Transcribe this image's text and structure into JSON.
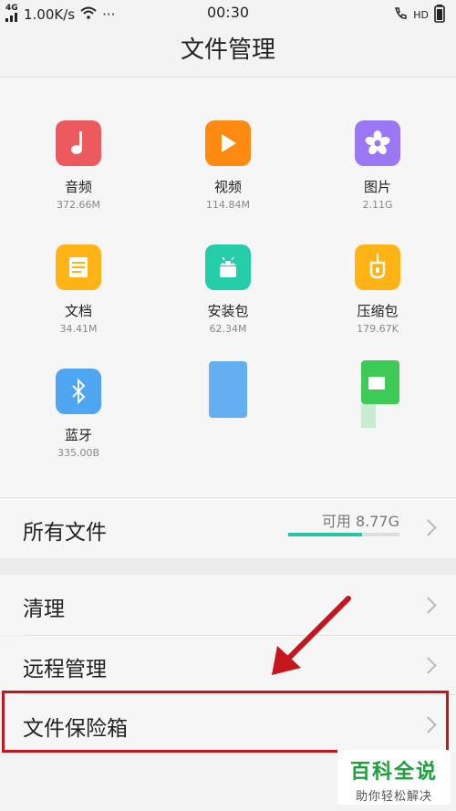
{
  "status_bar": {
    "network_type": "4G",
    "net_speed": "1.00K/s",
    "more": "···",
    "time": "00:30",
    "hd_label": "HD"
  },
  "header": {
    "title": "文件管理"
  },
  "categories": [
    {
      "label": "音频",
      "size": "372.66M",
      "icon": "music-note-icon",
      "color": "#ec5a5e"
    },
    {
      "label": "视频",
      "size": "114.84M",
      "icon": "play-icon",
      "color": "#ff8a12"
    },
    {
      "label": "图片",
      "size": "2.11G",
      "icon": "flower-icon",
      "color": "#9b77f5"
    },
    {
      "label": "文档",
      "size": "34.41M",
      "icon": "document-icon",
      "color": "#ffb314"
    },
    {
      "label": "安装包",
      "size": "62.34M",
      "icon": "android-icon",
      "color": "#25cda9"
    },
    {
      "label": "压缩包",
      "size": "179.67K",
      "icon": "zip-icon",
      "color": "#ffb314"
    },
    {
      "label": "蓝牙",
      "size": "335.00B",
      "icon": "bluetooth-icon",
      "color": "#4ea6f3"
    }
  ],
  "all_files": {
    "label": "所有文件",
    "available": "可用 8.77G",
    "used_fraction": 0.66,
    "bar_color": "#2ac3a8"
  },
  "menu": [
    {
      "label": "清理"
    },
    {
      "label": "远程管理"
    },
    {
      "label": "文件保险箱"
    }
  ],
  "watermark": {
    "title": "百科全说",
    "subtitle": "助你轻松解决",
    "color": "#1f9f3a"
  },
  "colors": {
    "highlight": "#c4161c",
    "accent": "#2ac3a8"
  }
}
